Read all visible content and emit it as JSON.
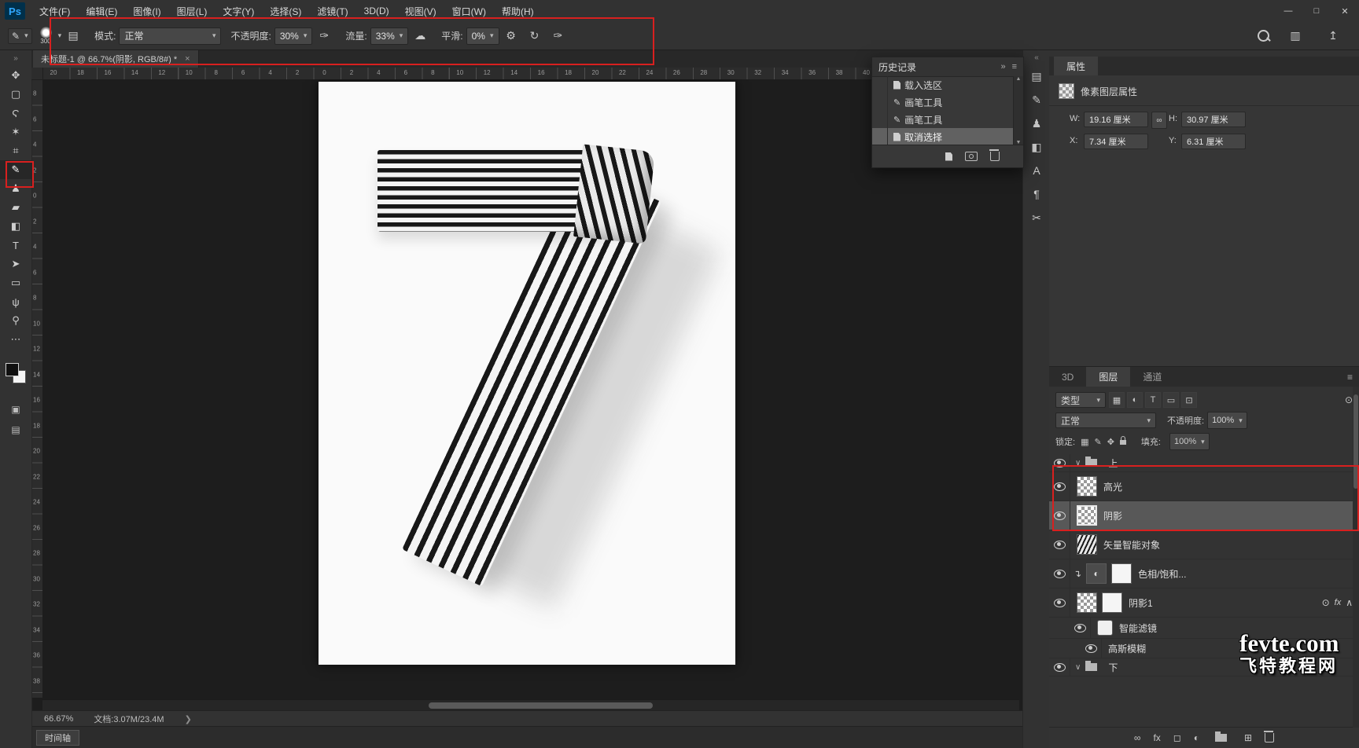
{
  "app": {
    "logo": "Ps"
  },
  "colors": {
    "annotation_red": "#d8201f",
    "selection_gray": "#585858",
    "canvas_bg": "#1d1d1d"
  },
  "menu_bar": {
    "items": [
      "文件(F)",
      "编辑(E)",
      "图像(I)",
      "图层(L)",
      "文字(Y)",
      "选择(S)",
      "滤镜(T)",
      "3D(D)",
      "视图(V)",
      "窗口(W)",
      "帮助(H)"
    ]
  },
  "window_controls": {
    "minimize": "—",
    "maximize": "□",
    "close": "✕"
  },
  "options_bar": {
    "brush_size": "300",
    "mode_label": "模式:",
    "mode_value": "正常",
    "opacity_label": "不透明度:",
    "opacity_value": "30%",
    "flow_label": "流量:",
    "flow_value": "33%",
    "smoothing_label": "平滑:",
    "smoothing_value": "0%",
    "icons": [
      {
        "name": "toggle-brush-settings-icon",
        "glyph": "▤"
      },
      {
        "name": "pressure-opacity-icon",
        "glyph": "✑"
      },
      {
        "name": "airbrush-icon",
        "glyph": "☁"
      },
      {
        "name": "gear-icon",
        "glyph": "⚙"
      },
      {
        "name": "brush-angle-icon",
        "glyph": "↻"
      },
      {
        "name": "pressure-size-icon",
        "glyph": "✑"
      }
    ]
  },
  "document_tab": {
    "title": "未标题-1 @ 66.7%(阴影, RGB/8#) *",
    "close": "×"
  },
  "toolbar": {
    "collapse": "»",
    "tools": [
      {
        "name": "move-tool",
        "glyph": "✥"
      },
      {
        "name": "marquee-tool",
        "glyph": "▢"
      },
      {
        "name": "lasso-tool",
        "glyph": "Ϛ"
      },
      {
        "name": "quick-selection-tool",
        "glyph": "✶"
      },
      {
        "name": "crop-tool",
        "glyph": "⌗"
      },
      {
        "name": "brush-tool",
        "glyph": "✎",
        "active": true
      },
      {
        "name": "clone-stamp-tool",
        "glyph": "♟"
      },
      {
        "name": "eraser-tool",
        "glyph": "▰"
      },
      {
        "name": "gradient-tool",
        "glyph": "◧"
      },
      {
        "name": "type-tool",
        "glyph": "T"
      },
      {
        "name": "path-selection-tool",
        "glyph": "➤"
      },
      {
        "name": "rectangle-tool",
        "glyph": "▭"
      },
      {
        "name": "hand-tool",
        "glyph": "ψ"
      },
      {
        "name": "zoom-tool",
        "glyph": "⚲"
      },
      {
        "name": "more-tools",
        "glyph": "⋯"
      }
    ]
  },
  "rulers": {
    "top": [
      "20",
      "18",
      "16",
      "14",
      "12",
      "10",
      "8",
      "6",
      "4",
      "2",
      "0",
      "2",
      "4",
      "6",
      "8",
      "10",
      "12",
      "14",
      "16",
      "18",
      "20",
      "22",
      "24",
      "26",
      "28",
      "30",
      "32",
      "34",
      "36",
      "38",
      "40"
    ],
    "left": [
      "8",
      "6",
      "4",
      "2",
      "0",
      "2",
      "4",
      "6",
      "8",
      "10",
      "12",
      "14",
      "16",
      "18",
      "20",
      "22",
      "24",
      "26",
      "28",
      "30",
      "32",
      "34",
      "36",
      "38"
    ]
  },
  "history_panel": {
    "title": "历史记录",
    "collapse_icon": "»",
    "menu_icon": "≡",
    "items": [
      {
        "label": "载入选区",
        "icon": "document"
      },
      {
        "label": "画笔工具",
        "icon": "brush"
      },
      {
        "label": "画笔工具",
        "icon": "brush"
      },
      {
        "label": "取消选择",
        "icon": "document",
        "selected": true
      }
    ],
    "footer_icons": [
      {
        "name": "new-document-from-state-icon",
        "css": "icon-doc"
      },
      {
        "name": "new-snapshot-icon",
        "css": "icon-camera"
      },
      {
        "name": "delete-state-icon",
        "css": "icon-trash"
      }
    ]
  },
  "right_strip": {
    "collapse": "«",
    "icons": [
      {
        "name": "brush-settings-panel-icon",
        "glyph": "▤"
      },
      {
        "name": "brushes-panel-icon",
        "glyph": "✎"
      },
      {
        "name": "clone-source-panel-icon",
        "glyph": "♟"
      },
      {
        "name": "color-panel-icon",
        "glyph": "◧"
      },
      {
        "name": "character-panel-icon",
        "glyph": "A"
      },
      {
        "name": "paragraph-panel-icon",
        "glyph": "¶"
      },
      {
        "name": "notes-panel-icon",
        "glyph": "✂"
      }
    ]
  },
  "properties_panel": {
    "tab": "属性",
    "header": "像素图层属性",
    "w_label": "W:",
    "w_value": "19.16 厘米",
    "h_label": "H:",
    "h_value": "30.97 厘米",
    "x_label": "X:",
    "x_value": "7.34 厘米",
    "y_label": "Y:",
    "y_value": "6.31 厘米",
    "link_icon": "∞"
  },
  "layers_panel": {
    "tabs": [
      "3D",
      "图层",
      "通道"
    ],
    "active_tab": "图层",
    "menu_icon": "≡",
    "filter_label": "类型",
    "filter_icons": [
      {
        "name": "filter-pixel-layers-icon",
        "glyph": "▦"
      },
      {
        "name": "filter-adjustment-layers-icon",
        "glyph": "◐"
      },
      {
        "name": "filter-type-layers-icon",
        "glyph": "T"
      },
      {
        "name": "filter-shape-layers-icon",
        "glyph": "▭"
      },
      {
        "name": "filter-smart-objects-icon",
        "glyph": "⊡"
      }
    ],
    "blend_mode": "正常",
    "opacity_label": "不透明度:",
    "opacity_value": "100%",
    "lock_label": "锁定:",
    "lock_icons": [
      {
        "name": "lock-transparent-icon",
        "glyph": "▦"
      },
      {
        "name": "lock-pixels-icon",
        "glyph": "✎"
      },
      {
        "name": "lock-position-icon",
        "glyph": "✥"
      },
      {
        "name": "lock-all-icon",
        "glyph": "",
        "css": "icon-lock"
      }
    ],
    "fill_label": "填充:",
    "fill_value": "100%",
    "fx_label": "fx",
    "layers": [
      {
        "type": "group",
        "label": "上"
      },
      {
        "type": "layer",
        "label": "高光",
        "thumb": "checker"
      },
      {
        "type": "layer",
        "label": "阴影",
        "thumb": "checker",
        "selected": true
      },
      {
        "type": "layer",
        "label": "矢量智能对象",
        "thumb": "seven"
      },
      {
        "type": "adjustment",
        "label": "色相/饱和...",
        "clipped": true
      },
      {
        "type": "layer",
        "label": "阴影1",
        "thumb": "checker",
        "mask": true,
        "has_fx": true
      },
      {
        "type": "smart-filter-header",
        "label": "智能滤镜"
      },
      {
        "type": "smart-filter",
        "label": "高斯模糊"
      },
      {
        "type": "group",
        "label": "下"
      }
    ],
    "bottom_icons": [
      {
        "name": "link-layers-icon",
        "glyph": "∞"
      },
      {
        "name": "layer-style-icon",
        "glyph": "fx"
      },
      {
        "name": "add-mask-icon",
        "glyph": "◻"
      },
      {
        "name": "new-adjustment-icon",
        "glyph": "◐"
      },
      {
        "name": "new-group-icon",
        "glyph": "",
        "css": "icon-folder"
      },
      {
        "name": "new-layer-icon",
        "glyph": "⊞"
      },
      {
        "name": "delete-layer-icon",
        "glyph": "",
        "css": "icon-trash"
      }
    ]
  },
  "status_bar": {
    "zoom": "66.67%",
    "doc_info": "文档:3.07M/23.4M",
    "chevron": "❯"
  },
  "timeline": {
    "button": "时间轴"
  },
  "watermark": {
    "line1": "fevte.com",
    "line2": "飞特教程网"
  }
}
